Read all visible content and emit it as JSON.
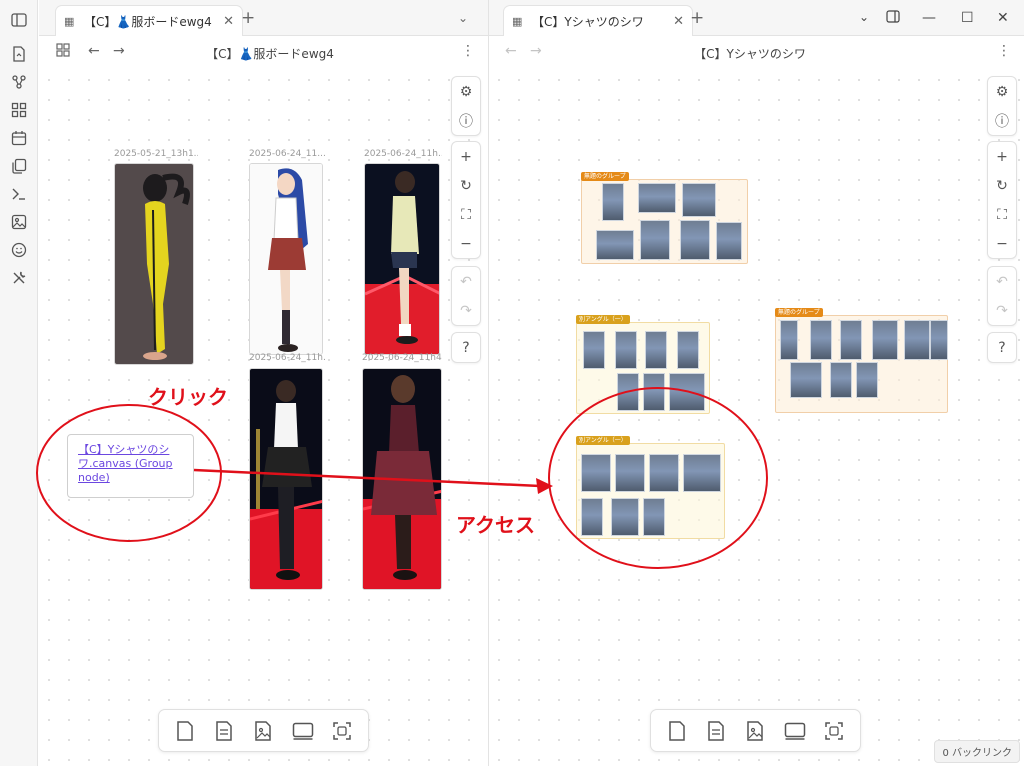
{
  "left": {
    "tab_title": "【C】👗服ボードewg4",
    "view_title": "【C】👗服ボードewg4",
    "cards": [
      {
        "label": "2025-05-21_13h1..."
      },
      {
        "label": "2025-06-24_11..."
      },
      {
        "label": "2025-06-24_11h..."
      },
      {
        "label": "2025-06-24_11h..."
      },
      {
        "label": "2025-06-24_11h4..."
      }
    ],
    "link_node_text": "【C】Yシャツのシワ.canvas (Group node)"
  },
  "right": {
    "tab_title": "【C】Yシャツのシワ",
    "view_title": "【C】Yシャツのシワ",
    "groups": [
      {
        "label": "無題のグループ"
      },
      {
        "label": "別アングル（一）"
      },
      {
        "label": "無題のグループ"
      },
      {
        "label": "別アングル（一）"
      }
    ]
  },
  "annotations": {
    "click": "クリック",
    "access": "アクセス"
  },
  "status": {
    "backlinks": "0 バックリンク"
  },
  "colors": {
    "annotation_red": "#e0101a",
    "link_purple": "#6b47e0",
    "group_orange": "#e58a17"
  },
  "icons": {
    "ribbon": [
      "file-switch-icon",
      "graph-icon",
      "canvas-icon",
      "calendar-icon",
      "copy-icon",
      "terminal-icon",
      "image-icon",
      "smiley-icon",
      "tools-icon"
    ],
    "canvas_controls": [
      "settings-icon",
      "info-icon",
      "zoom-in-icon",
      "reset-icon",
      "fit-icon",
      "zoom-out-icon",
      "undo-icon",
      "redo-icon",
      "help-icon"
    ],
    "bottom_toolbar": [
      "new-note-icon",
      "new-file-icon",
      "new-media-icon",
      "new-group-icon",
      "new-embed-icon"
    ]
  }
}
